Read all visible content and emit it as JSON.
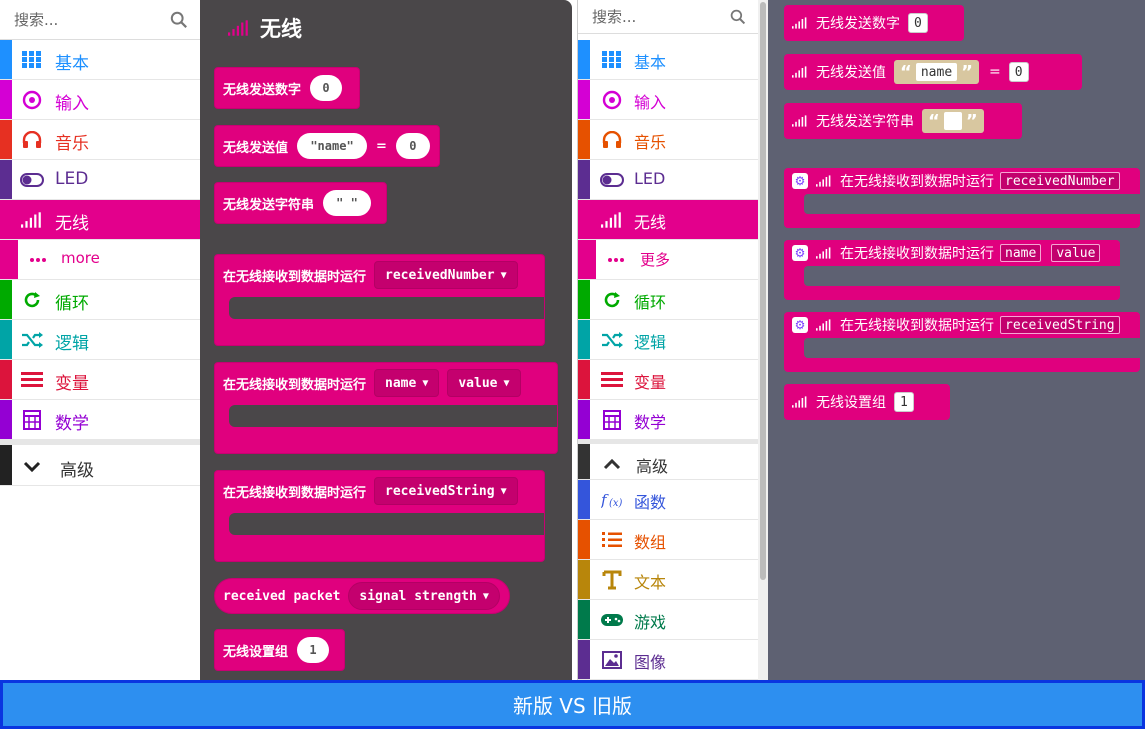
{
  "new_toolbox": {
    "search_placeholder": "搜索...",
    "categories": [
      {
        "label": "基本",
        "color": "#1e90ff",
        "icon": "grid-icon"
      },
      {
        "label": "输入",
        "color": "#d400d4",
        "icon": "target-icon"
      },
      {
        "label": "音乐",
        "color": "#e63022",
        "icon": "headphones-icon"
      },
      {
        "label": "LED",
        "color": "#5c2d91",
        "icon": "toggle-icon"
      },
      {
        "label": "无线",
        "color": "#e3008c",
        "icon": "signal-icon",
        "selected": true
      },
      {
        "label": "more",
        "color": "#e3008c",
        "icon": "dots-icon"
      },
      {
        "label": "循环",
        "color": "#00aa00",
        "icon": "refresh-icon"
      },
      {
        "label": "逻辑",
        "color": "#00a4a6",
        "icon": "shuffle-icon"
      },
      {
        "label": "变量",
        "color": "#dc143c",
        "icon": "lines-icon"
      },
      {
        "label": "数学",
        "color": "#9400d3",
        "icon": "calculator-icon"
      },
      {
        "label": "高级",
        "color": "#222222",
        "icon": "chevron-down-icon"
      }
    ]
  },
  "flyout": {
    "title": "无线",
    "blocks": {
      "send_number": {
        "label": "无线发送数字",
        "value": "0"
      },
      "send_value": {
        "label": "无线发送值",
        "name": "\"name\"",
        "eq": "=",
        "value": "0"
      },
      "send_string": {
        "label": "无线发送字符串",
        "value": "\" \""
      },
      "on_number": {
        "label": "在无线接收到数据时运行",
        "arg": "receivedNumber"
      },
      "on_value": {
        "label": "在无线接收到数据时运行",
        "arg1": "name",
        "arg2": "value"
      },
      "on_string": {
        "label": "在无线接收到数据时运行",
        "arg": "receivedString"
      },
      "packet": {
        "label": "received packet",
        "arg": "signal strength"
      },
      "set_group": {
        "label": "无线设置组",
        "value": "1"
      }
    }
  },
  "old_toolbox": {
    "search_placeholder": "搜索...",
    "categories": [
      {
        "label": "基本",
        "color": "#1e90ff",
        "icon": "grid-icon"
      },
      {
        "label": "输入",
        "color": "#d400d4",
        "icon": "target-icon"
      },
      {
        "label": "音乐",
        "color": "#e65100",
        "icon": "headphones-icon"
      },
      {
        "label": "LED",
        "color": "#5c2d91",
        "icon": "toggle-icon"
      },
      {
        "label": "无线",
        "color": "#e3008c",
        "icon": "signal-icon",
        "selected": true
      },
      {
        "label": "更多",
        "color": "#e3008c",
        "icon": "dots-icon"
      },
      {
        "label": "循环",
        "color": "#00aa00",
        "icon": "refresh-icon"
      },
      {
        "label": "逻辑",
        "color": "#00a4a6",
        "icon": "shuffle-icon"
      },
      {
        "label": "变量",
        "color": "#dc143c",
        "icon": "lines-icon"
      },
      {
        "label": "数学",
        "color": "#9400d3",
        "icon": "calculator-icon"
      },
      {
        "label": "高级",
        "color": "#333333",
        "icon": "chevron-up-icon"
      },
      {
        "label": "函数",
        "color": "#3455db",
        "icon": "function-icon"
      },
      {
        "label": "数组",
        "color": "#e65100",
        "icon": "list-icon"
      },
      {
        "label": "文本",
        "color": "#b8860b",
        "icon": "text-icon"
      },
      {
        "label": "游戏",
        "color": "#007a4b",
        "icon": "gamepad-icon"
      },
      {
        "label": "图像",
        "color": "#5c2d91",
        "icon": "image-icon"
      }
    ]
  },
  "workspace": {
    "blocks": {
      "send_number": {
        "label": "无线发送数字",
        "value": "0"
      },
      "send_value": {
        "label": "无线发送值",
        "name": "name",
        "eq": "=",
        "value": "0"
      },
      "send_string": {
        "label": "无线发送字符串"
      },
      "on_number": {
        "label": "在无线接收到数据时运行",
        "arg": "receivedNumber"
      },
      "on_value": {
        "label": "在无线接收到数据时运行",
        "arg1": "name",
        "arg2": "value"
      },
      "on_string": {
        "label": "在无线接收到数据时运行",
        "arg": "receivedString"
      },
      "set_group": {
        "label": "无线设置组",
        "value": "1"
      }
    }
  },
  "footer": {
    "text": "新版 VS 旧版"
  }
}
